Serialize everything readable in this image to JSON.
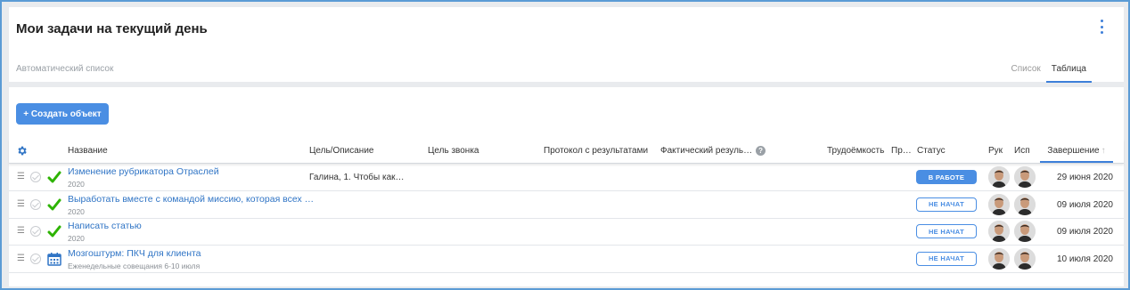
{
  "header": {
    "title": "Мои задачи на текущий день",
    "subtitle": "Автоматический список",
    "views": [
      "Список",
      "Таблица"
    ],
    "active_view": "Таблица",
    "more_icon": "more-vertical-icon"
  },
  "toolbar": {
    "create_label": "+ Создать объект"
  },
  "table": {
    "settings_icon": "gear-icon",
    "columns": {
      "name": "Название",
      "goal": "Цель/Описание",
      "call_goal": "Цель звонка",
      "protocol": "Протокол с результатами",
      "actual": "Фактический резуль…",
      "effort": "Трудоёмкость",
      "pr": "Пр…",
      "status": "Статус",
      "head": "Рук",
      "exec": "Исп",
      "end": "Завершение",
      "sort_arrow": "↑",
      "help": "?"
    },
    "rows": [
      {
        "name": "Изменение рубрикатора Отраслей",
        "sub": "2020",
        "goal": "Галина, 1. Чтобы как…",
        "status": "В РАБОТЕ",
        "status_type": "work",
        "date": "29 июня 2020",
        "drag": "☰",
        "icon": "green-check-icon"
      },
      {
        "name": "Выработать вместе с командой миссию, которая всех …",
        "sub": "2020",
        "goal": "",
        "status": "НЕ НАЧАТ",
        "status_type": "new",
        "date": "09 июля 2020",
        "drag": "☰",
        "icon": "green-check-icon"
      },
      {
        "name": "Написать статью",
        "sub": "2020",
        "goal": "",
        "status": "НЕ НАЧАТ",
        "status_type": "new",
        "date": "09 июля 2020",
        "drag": "☰",
        "icon": "green-check-icon"
      },
      {
        "name": "Мозгоштурм: ПКЧ для клиента",
        "sub": "Еженедельные совещания 6-10 июля",
        "goal": "",
        "status": "НЕ НАЧАТ",
        "status_type": "new",
        "date": "10 июля 2020",
        "drag": "☰",
        "icon": "calendar-icon"
      }
    ]
  },
  "colors": {
    "accent": "#4a8ee3",
    "link": "#2f74c5",
    "check": "#2db300",
    "border": "#5b9bd5"
  }
}
